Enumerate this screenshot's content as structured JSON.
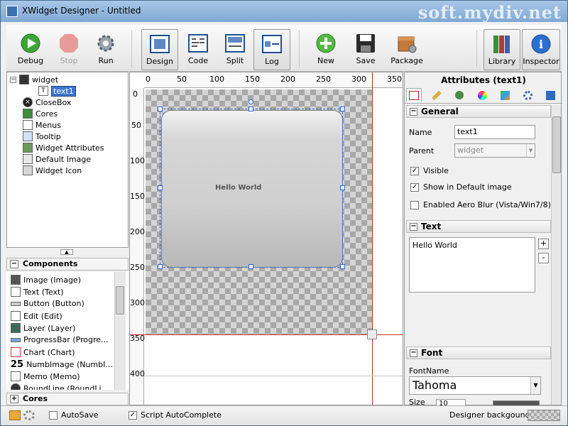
{
  "window": {
    "title": "XWidget Designer - Untitled",
    "watermark": "soft.mydiv.net"
  },
  "toolbar": {
    "buttons": [
      {
        "label": "Debug",
        "icon": "debug-play-icon",
        "enabled": true
      },
      {
        "label": "Stop",
        "icon": "stop-icon",
        "enabled": false
      },
      {
        "label": "Run",
        "icon": "run-gear-icon",
        "enabled": true
      },
      {
        "label": "Design",
        "icon": "design-icon",
        "active": true
      },
      {
        "label": "Code",
        "icon": "code-icon"
      },
      {
        "label": "Split",
        "icon": "split-icon"
      },
      {
        "label": "Log",
        "icon": "log-icon"
      },
      {
        "label": "New",
        "icon": "new-plus-icon"
      },
      {
        "label": "Save",
        "icon": "save-floppy-icon"
      },
      {
        "label": "Package",
        "icon": "package-icon"
      },
      {
        "label": "Library",
        "icon": "library-books-icon",
        "active": true
      },
      {
        "label": "Inspector",
        "icon": "inspector-info-icon",
        "active": true
      }
    ]
  },
  "tree": {
    "items": [
      {
        "label": "widget"
      },
      {
        "label": "text1",
        "selected": true
      },
      {
        "label": "CloseBox"
      },
      {
        "label": "Cores"
      },
      {
        "label": "Menus"
      },
      {
        "label": "Tooltip"
      },
      {
        "label": "Widget Attributes"
      },
      {
        "label": "Default Image"
      },
      {
        "label": "Widget Icon"
      }
    ]
  },
  "components": {
    "header": "Components",
    "items": [
      "Image (Image)",
      "Text (Text)",
      "Button (Button)",
      "Edit (Edit)",
      "Layer (Layer)",
      "ProgressBar (Progre...",
      "Chart (Chart)",
      "NumbImage (NumbI...",
      "Memo (Memo)",
      "RoundLine (RoundLi..."
    ]
  },
  "cores": {
    "header": "Cores"
  },
  "canvas": {
    "ruler_h": [
      "0",
      "50",
      "100",
      "150",
      "200",
      "250",
      "300",
      "350"
    ],
    "ruler_v": [
      "0",
      "50",
      "100",
      "150",
      "200",
      "250",
      "300",
      "350",
      "400"
    ],
    "widget_text": "Hello World"
  },
  "attributes": {
    "title": "Attributes (text1)",
    "general": {
      "header": "General",
      "name_label": "Name",
      "name_value": "text1",
      "parent_label": "Parent",
      "parent_value": "widget",
      "visible_label": "Visible",
      "visible_checked": true,
      "show_default_label": "Show in Default image",
      "show_default_checked": true,
      "aero_label": "Enabled Aero Blur (Vista/Win7/8)",
      "aero_checked": false
    },
    "text": {
      "header": "Text",
      "value": "Hello World",
      "add": "+",
      "remove": "-"
    },
    "font": {
      "header": "Font",
      "fontname_label": "FontName",
      "fontname_value": "Tahoma",
      "size_label": "Size",
      "size_value": "10"
    }
  },
  "statusbar": {
    "autosave_label": "AutoSave",
    "autosave_checked": false,
    "autocomplete_label": "Script AutoComplete",
    "autocomplete_checked": true,
    "designer_bg_label": "Designer backgound"
  },
  "colors": {
    "accent": "#3b78d4",
    "guide": "#c0302a",
    "selection": "#3366cc"
  }
}
